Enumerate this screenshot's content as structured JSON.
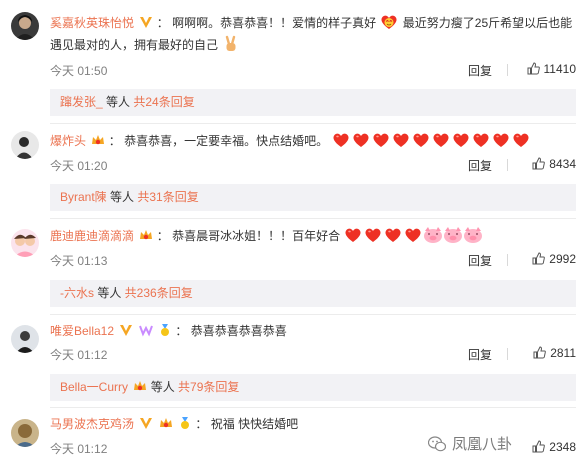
{
  "comments": [
    {
      "user": "奚嘉秋英珠怡悦",
      "sep": "：",
      "text_a": "啊啊啊。恭喜恭喜！！爱情的样子真好",
      "text_b": " 最近努力瘦了25斤希望以后也能遇见最对的人，拥有最好的自己",
      "time": "今天 01:50",
      "reply_label": "回复",
      "likes": "11410",
      "sub_user": "蹿发张_",
      "sub_text": " 等人 ",
      "sub_more": "共24条回复"
    },
    {
      "user": "爆炸头",
      "sep": "：",
      "text_a": "恭喜恭喜，一定要幸福。快点结婚吧。",
      "time": "今天 01:20",
      "reply_label": "回复",
      "likes": "8434",
      "sub_user": "Byrant陳",
      "sub_text": " 等人 ",
      "sub_more": "共31条回复"
    },
    {
      "user": "鹿迪鹿迪滴滴滴",
      "sep": "：",
      "text_a": "恭喜晨哥冰冰姐！！！百年好合",
      "time": "今天 01:13",
      "reply_label": "回复",
      "likes": "2992",
      "sub_user": "-六水s",
      "sub_text": " 等人 ",
      "sub_more": "共236条回复"
    },
    {
      "user": "唯爱Bella12",
      "sep": "：",
      "text_a": "恭喜恭喜恭喜恭喜",
      "time": "今天 01:12",
      "reply_label": "回复",
      "likes": "2811",
      "sub_user": "Bella一Curry",
      "sub_text": " 等人 ",
      "sub_more": "共79条回复"
    },
    {
      "user": "马男波杰克鸡汤",
      "sep": "：",
      "text_a": "祝福 快快结婚吧",
      "time": "今天 01:12",
      "reply_label": "回复",
      "likes": "2348"
    }
  ],
  "watermark": "凤凰八卦",
  "colors": {
    "username": "#eb7350",
    "meta": "#808080",
    "subbox_bg": "#f2f2f5",
    "heart": "#ee3124",
    "vip_yellow": "#f5a623"
  }
}
